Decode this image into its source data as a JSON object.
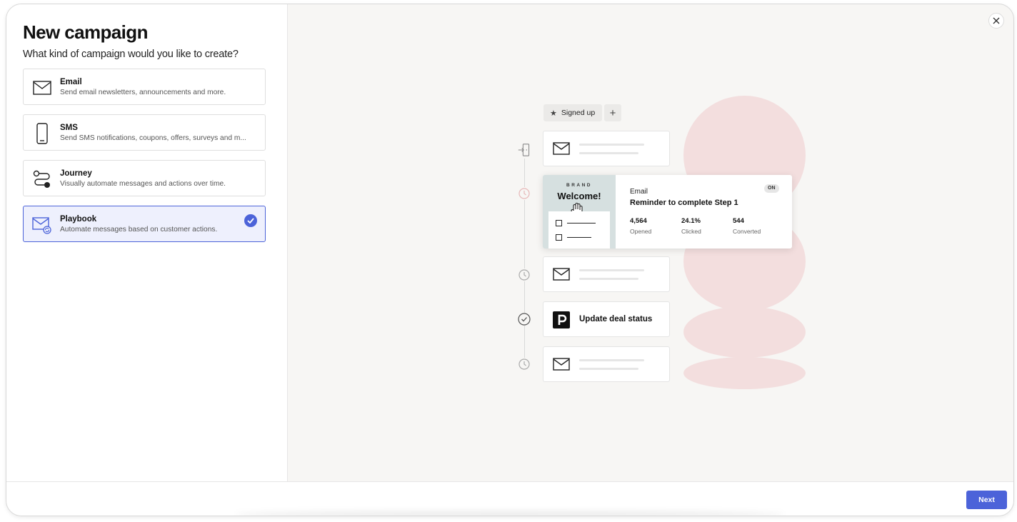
{
  "header": {
    "title": "New campaign",
    "subtitle": "What kind of campaign would you like to create?"
  },
  "options": [
    {
      "title": "Email",
      "description": "Send email newsletters, announcements and more.",
      "icon": "envelope-icon",
      "selected": false
    },
    {
      "title": "SMS",
      "description": "Send SMS notifications, coupons, offers, surveys and m...",
      "icon": "phone-icon",
      "selected": false
    },
    {
      "title": "Journey",
      "description": "Visually automate messages and actions over time.",
      "icon": "journey-icon",
      "selected": false
    },
    {
      "title": "Playbook",
      "description": "Automate messages based on customer actions.",
      "icon": "playbook-icon",
      "selected": true
    }
  ],
  "preview": {
    "trigger_label": "Signed up",
    "add_label": "+",
    "email_card": {
      "brand": "BRAND",
      "welcome": "Welcome!",
      "type_label": "Email",
      "name": "Reminder to complete Step 1",
      "status": "ON",
      "stats": [
        {
          "value": "4,564",
          "label": "Opened"
        },
        {
          "value": "24.1%",
          "label": "Clicked"
        },
        {
          "value": "544",
          "label": "Converted"
        }
      ]
    },
    "deal_card_label": "Update deal status"
  },
  "footer": {
    "next_label": "Next"
  },
  "colors": {
    "accent": "#4c63d9",
    "selected_bg": "#eef0fd",
    "blob": "#f3dede",
    "panel_bg": "#f7f6f4"
  }
}
